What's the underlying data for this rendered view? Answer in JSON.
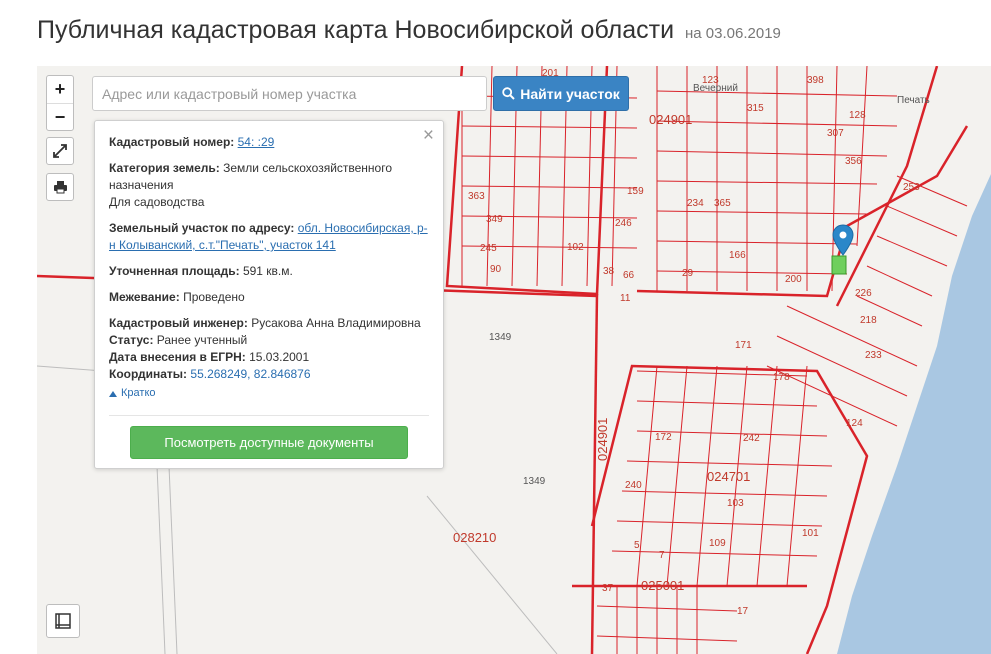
{
  "page": {
    "title": "Публичная кадастровая карта Новосибирской области",
    "date": "на 03.06.2019"
  },
  "controls": {
    "zoom_in": "+",
    "zoom_out": "−"
  },
  "search": {
    "placeholder": "Адрес или кадастровый номер участка",
    "button_label": "Найти участок"
  },
  "info": {
    "cad_number_label": "Кадастровый номер:",
    "cad_number_value": "54:          :29",
    "category_label": "Категория земель:",
    "category_value": "Земли сельскохозяйственного назначения",
    "category_value2": "Для садоводства",
    "address_label": "Земельный участок по адресу:",
    "address_value": "обл. Новосибирская, р-н Колыванский, с.т.\"Печать\", участок 141",
    "area_label": "Уточненная площадь:",
    "area_value": "591 кв.м.",
    "survey_label": "Межевание:",
    "survey_value": "Проведено",
    "engineer_label": "Кадастровый инженер:",
    "engineer_value": "Русакова Анна Владимировна",
    "status_label": "Статус:",
    "status_value": "Ранее учтенный",
    "egrn_label": "Дата внесения в ЕГРН:",
    "egrn_value": "15.03.2001",
    "coords_label": "Координаты:",
    "coords_value": "55.268249, 82.846876",
    "toggle_label": "Кратко",
    "docs_button": "Посмотреть доступные документы",
    "close": "×"
  },
  "map": {
    "quarter_labels": [
      "024901",
      "024901",
      "024701",
      "028210",
      "025001"
    ],
    "big_numbers": [
      "1349",
      "1349"
    ],
    "road_labels": [
      "Вечерний",
      "Печать"
    ],
    "parcel_numbers": [
      "201",
      "123",
      "398",
      "315",
      "128",
      "307",
      "356",
      "253",
      "363",
      "349",
      "234",
      "365",
      "166",
      "200",
      "90",
      "245",
      "102",
      "246",
      "159",
      "226",
      "218",
      "124",
      "242",
      "240",
      "172",
      "171",
      "178",
      "233",
      "37",
      "17",
      "109",
      "101",
      "103",
      "7",
      "5",
      "11",
      "29",
      "38",
      "66"
    ],
    "colors": {
      "parcel_line": "#d9232a",
      "quarter_line": "#d9232a",
      "background": "#f3f2ef",
      "water": "#a9c7e2",
      "highlight": "#6fcf5d",
      "marker": "#2a87c9"
    }
  }
}
